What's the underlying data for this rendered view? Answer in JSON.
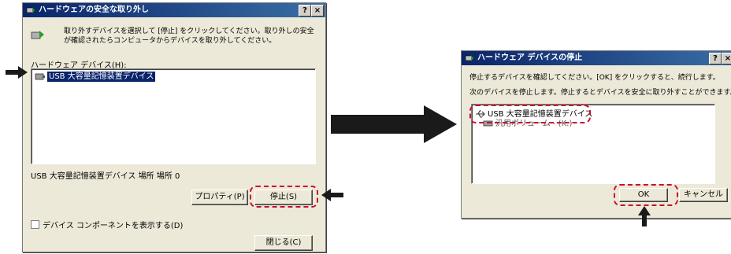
{
  "left_window": {
    "title": "ハードウェアの安全な取り外し",
    "title_buttons": [
      "?",
      "×"
    ],
    "instruction": "取り外すデバイスを選択して [停止] をクリックしてください。取り外しの安全が確認されたらコンピュータからデバイスを取り外してください。",
    "hardware_label": "ハードウェア デバイス(H):",
    "devices": [
      "USB 大容量記憶装置デバイス"
    ],
    "status_text": "USB 大容量記憶装置デバイス 場所 場所 0",
    "properties_button": "プロパティ(P)",
    "stop_button": "停止(S)",
    "show_components_label": "デバイス コンポーネントを表示する(D)",
    "close_button": "閉じる(C)"
  },
  "right_window": {
    "title": "ハードウェア デバイスの停止",
    "title_buttons": [
      "?",
      "×"
    ],
    "line1": "停止するデバイスを確認してください。[OK] をクリックすると、続行します。",
    "line2": "次のデバイスを停止します。停止するとデバイスを安全に取り外すことができます。",
    "devices": [
      "USB 大容量記憶装置デバイス",
      "汎用ボリューム - (K:)"
    ],
    "ok_button": "OK",
    "cancel_button": "キャンセル"
  },
  "colors": {
    "titlebar": "#0a246a",
    "highlight": "#c8102e",
    "arrow": "#1a1a1a"
  }
}
